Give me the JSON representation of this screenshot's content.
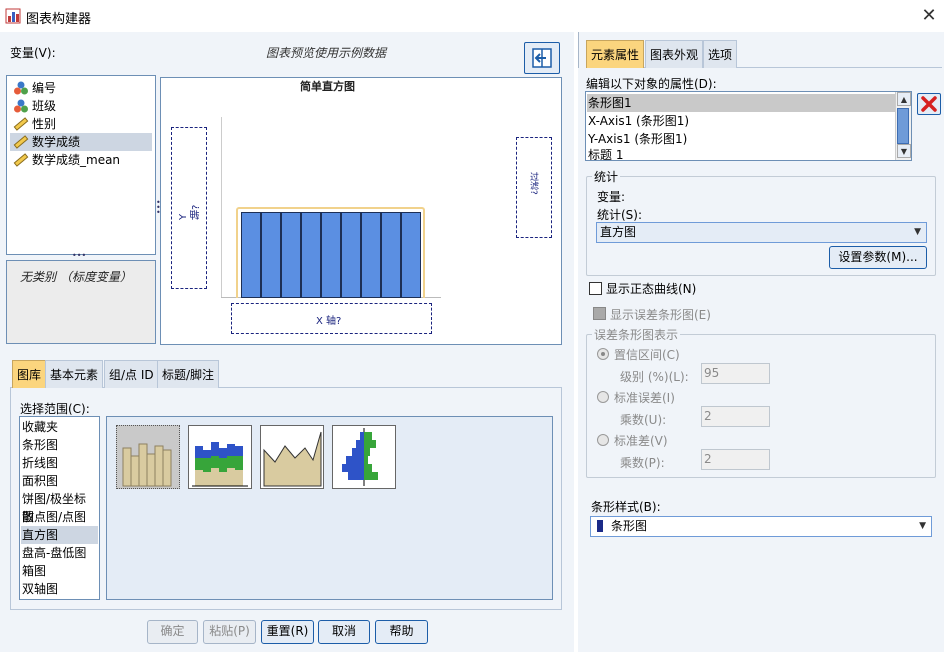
{
  "window": {
    "title": "图表构建器",
    "close_glyph": "✕"
  },
  "variables": {
    "label": "变量(V):",
    "items": [
      {
        "label": "编号",
        "icon": "nominal-icon",
        "selected": false
      },
      {
        "label": "班级",
        "icon": "nominal-icon",
        "selected": false
      },
      {
        "label": "性别",
        "icon": "scale-icon",
        "selected": false
      },
      {
        "label": "数学成绩",
        "icon": "scale-icon",
        "selected": true
      },
      {
        "label": "数学成绩_mean",
        "icon": "scale-icon",
        "selected": false
      }
    ],
    "category_text": "无类别 （标度变量）"
  },
  "canvas": {
    "note": "图表预览使用示例数据",
    "chart_title": "简单直方图",
    "y_zone": "Y 轴?",
    "x_zone": "X 轴?",
    "filter_zone": "过滤?",
    "bar_count": 9
  },
  "gallery": {
    "tabs": [
      {
        "label": "图库",
        "active": true
      },
      {
        "label": "基本元素",
        "active": false
      },
      {
        "label": "组/点 ID",
        "active": false
      },
      {
        "label": "标题/脚注",
        "active": false
      }
    ],
    "scope_label": "选择范围(C):",
    "scope_items": [
      {
        "label": "收藏夹",
        "selected": false
      },
      {
        "label": "条形图",
        "selected": false
      },
      {
        "label": "折线图",
        "selected": false
      },
      {
        "label": "面积图",
        "selected": false
      },
      {
        "label": "饼图/极坐标图",
        "selected": false
      },
      {
        "label": "散点图/点图",
        "selected": false
      },
      {
        "label": "直方图",
        "selected": true
      },
      {
        "label": "盘高-盘低图",
        "selected": false
      },
      {
        "label": "箱图",
        "selected": false
      },
      {
        "label": "双轴图",
        "selected": false
      }
    ],
    "thumbnails": [
      {
        "name": "simple-histogram-thumb",
        "selected": true
      },
      {
        "name": "stacked-histogram-thumb",
        "selected": false
      },
      {
        "name": "frequency-polygon-thumb",
        "selected": false
      },
      {
        "name": "population-pyramid-thumb",
        "selected": false
      }
    ]
  },
  "buttons": {
    "ok": "确定",
    "paste": "粘贴(P)",
    "reset": "重置(R)",
    "cancel": "取消",
    "help": "帮助"
  },
  "right": {
    "tabs": [
      {
        "label": "元素属性",
        "active": true
      },
      {
        "label": "图表外观",
        "active": false
      },
      {
        "label": "选项",
        "active": false
      }
    ],
    "props_label": "编辑以下对象的属性(D):",
    "props_items": [
      {
        "label": "条形图1",
        "selected": true
      },
      {
        "label": "X-Axis1 (条形图1)",
        "selected": false
      },
      {
        "label": "Y-Axis1 (条形图1)",
        "selected": false
      },
      {
        "label": "标题 1",
        "selected": false
      }
    ],
    "stats": {
      "legend": "统计",
      "variable_label": "变量:",
      "statistic_label": "统计(S):",
      "statistic_value": "直方图",
      "set_params": "设置参数(M)..."
    },
    "normal_curve": "显示正态曲线(N)",
    "error_bars": "显示误差条形图(E)",
    "error_group": {
      "legend": "误差条形图表示",
      "ci": "置信区间(C)",
      "level_label": "级别 (%)(L):",
      "level_value": "95",
      "se": "标准误差(I)",
      "se_mult_label": "乘数(U):",
      "se_mult_value": "2",
      "sd": "标准差(V)",
      "sd_mult_label": "乘数(P):",
      "sd_mult_value": "2"
    },
    "bar_style_label": "条形样式(B):",
    "bar_style_value": "条形图"
  },
  "colors": {
    "bar_fill": "#5b8fe2",
    "active_tab": "#fbd57e",
    "accent_border": "#1c5da8"
  }
}
